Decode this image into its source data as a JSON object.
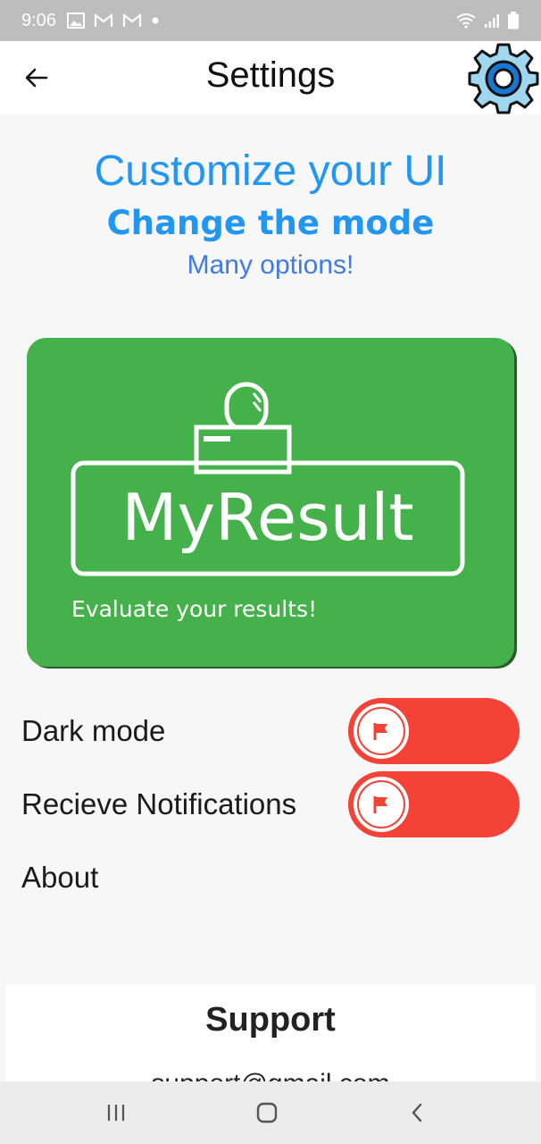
{
  "status_bar": {
    "time": "9:06",
    "left_icons": [
      "image-icon",
      "gmail-icon",
      "gmail-icon",
      "dot-icon"
    ],
    "right_icons": [
      "wifi-icon",
      "signal-icon",
      "battery-icon"
    ]
  },
  "app_bar": {
    "title": "Settings",
    "back_icon": "back-arrow-icon",
    "action_icon": "gear-icon"
  },
  "header": {
    "title": "Customize your UI",
    "subtitle": "Change the mode",
    "caption": "Many options!"
  },
  "logo": {
    "brand": "MyResult",
    "tagline": "Evaluate your results!"
  },
  "settings": {
    "dark_mode": {
      "label": "Dark mode",
      "state": "off"
    },
    "notifications": {
      "label": "Recieve Notifications",
      "state": "off"
    },
    "about": {
      "label": "About"
    }
  },
  "support": {
    "title": "Support",
    "email": "support@gmail.com"
  },
  "nav_bar": {
    "icons": [
      "recent-apps-icon",
      "home-icon",
      "back-icon"
    ]
  },
  "colors": {
    "accent_blue": "#2196f3",
    "toggle_red": "#f44336",
    "logo_green": "#45b14a"
  }
}
